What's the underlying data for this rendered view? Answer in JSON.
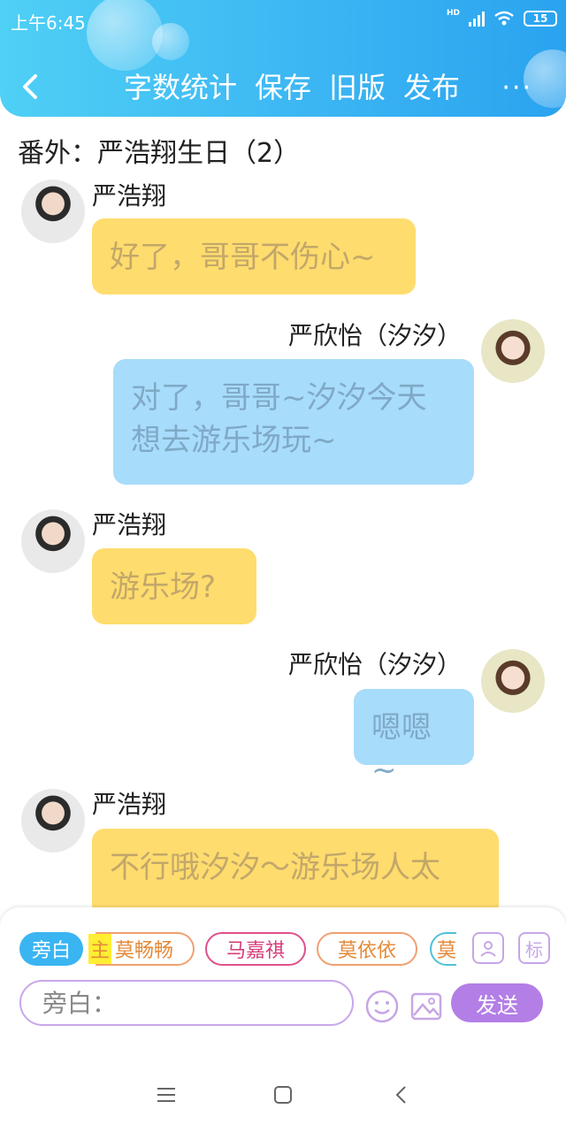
{
  "status_bar": {
    "time": "上午6:45",
    "network": "HD",
    "battery": "15"
  },
  "nav": {
    "actions": [
      "字数统计",
      "保存",
      "旧版",
      "发布"
    ],
    "more": "···"
  },
  "chapter_title": "番外：严浩翔生日（2）",
  "messages": [
    {
      "side": "left",
      "name": "严浩翔",
      "text": "好了，哥哥不伤心~"
    },
    {
      "side": "right",
      "name": "严欣怡（汐汐）",
      "text": "对了，哥哥~汐汐今天想去游乐场玩~"
    },
    {
      "side": "left",
      "name": "严浩翔",
      "text": "游乐场?"
    },
    {
      "side": "right",
      "name": "严欣怡（汐汐）",
      "text": "嗯嗯~"
    },
    {
      "side": "left",
      "name": "严浩翔",
      "text": "不行哦汐汐～游乐场人太"
    }
  ],
  "roles": {
    "active": "旁白",
    "highlight": "主",
    "items": [
      "莫畅畅",
      "马嘉祺",
      "莫依依",
      "莫"
    ]
  },
  "tools": {
    "role_button": "role-icon",
    "tag_button": "标"
  },
  "input": {
    "placeholder": "旁白："
  },
  "send_label": "发送",
  "colors": {
    "header": "#3cb6f3",
    "left_bubble": "#ffdc6e",
    "right_bubble": "#a7dcfa",
    "send": "#b37ee6"
  }
}
